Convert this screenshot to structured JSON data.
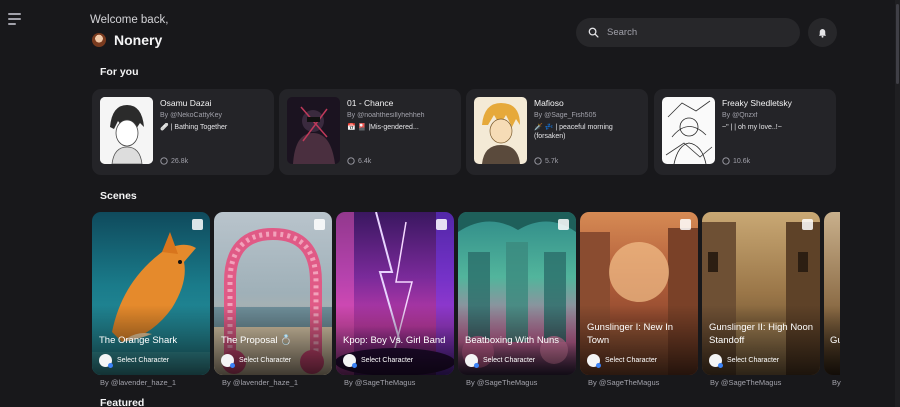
{
  "header": {
    "welcome": "Welcome back,",
    "username": "Nonery",
    "search_placeholder": "Search"
  },
  "sections": {
    "for_you": "For you",
    "scenes": "Scenes",
    "featured": "Featured"
  },
  "for_you": [
    {
      "name": "Osamu Dazai",
      "by": "By @NekoCattyKey",
      "desc": "🩹 | Bathing Together",
      "count": "26.8k"
    },
    {
      "name": "01 - Chance",
      "by": "By @noahthesillyhehheh",
      "desc": "📅 🎴 |Mis-gendered...",
      "count": "6.4k"
    },
    {
      "name": "Mafioso",
      "by": "By @Sage_Fish505",
      "desc": "🗡️ 💤 | peaceful morning (forsaken)",
      "count": "5.7k"
    },
    {
      "name": "Freaky Shedletsky",
      "by": "By @Qnzxf",
      "desc": "~\" | | oh my love..!~",
      "count": "10.6k"
    }
  ],
  "scenes": [
    {
      "title": "The Orange Shark",
      "select": "Select Character",
      "by": "By @lavender_haze_1"
    },
    {
      "title": "The Proposal 💍",
      "select": "Select Character",
      "by": "By @lavender_haze_1"
    },
    {
      "title": "Kpop: Boy Vs. Girl Band",
      "select": "Select Character",
      "by": "By @SageTheMagus"
    },
    {
      "title": "Beatboxing With Nuns",
      "select": "Select Character",
      "by": "By @SageTheMagus"
    },
    {
      "title": "Gunslinger I: New In Town",
      "select": "Select Character",
      "by": "By @SageTheMagus"
    },
    {
      "title": "Gunslinger II: High Noon Standoff",
      "select": "Select Character",
      "by": "By @SageTheMagus"
    },
    {
      "title": "Gu Ca",
      "select": "",
      "by": "By"
    }
  ],
  "icons": {
    "menu": "menu-icon",
    "search": "search-icon",
    "notification": "bell-icon",
    "chat": "chat-bubble-icon",
    "scene_badge": "bookmark-icon"
  }
}
